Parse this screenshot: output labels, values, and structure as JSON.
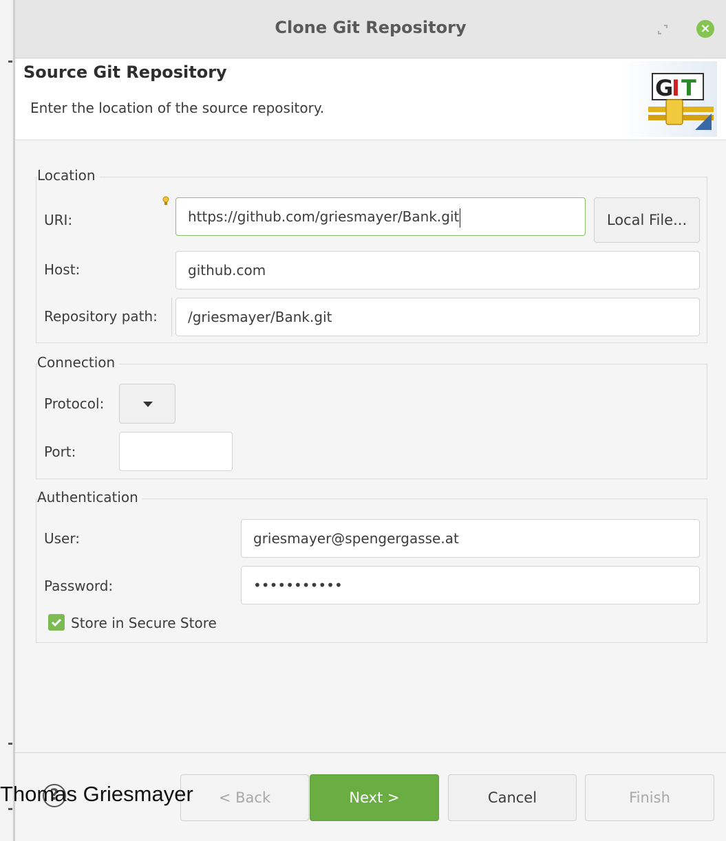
{
  "window": {
    "title": "Clone Git Repository"
  },
  "header": {
    "title": "Source Git Repository",
    "description": "Enter the location of the source repository."
  },
  "logo": {
    "text_g": "G",
    "text_i": "I",
    "text_t": "T"
  },
  "location": {
    "group_label": "Location",
    "uri_label": "URI:",
    "uri_value": "https://github.com/griesmayer/Bank.git",
    "local_file_button": "Local File...",
    "host_label": "Host:",
    "host_value": "github.com",
    "path_label": "Repository path:",
    "path_value": "/griesmayer/Bank.git"
  },
  "connection": {
    "group_label": "Connection",
    "protocol_label": "Protocol:",
    "port_label": "Port:",
    "port_value": ""
  },
  "authentication": {
    "group_label": "Authentication",
    "user_label": "User:",
    "user_value": "griesmayer@spengergasse.at",
    "password_label": "Password:",
    "password_value": "•••••••••••",
    "store_label": "Store in Secure Store",
    "store_checked": true
  },
  "footer": {
    "back_button": "< Back",
    "next_button": "Next >",
    "cancel_button": "Cancel",
    "finish_button": "Finish"
  },
  "watermark": {
    "text": "Thomas Griesmayer"
  },
  "colors": {
    "accent_green": "#6aae43",
    "close_green": "#86c451"
  }
}
